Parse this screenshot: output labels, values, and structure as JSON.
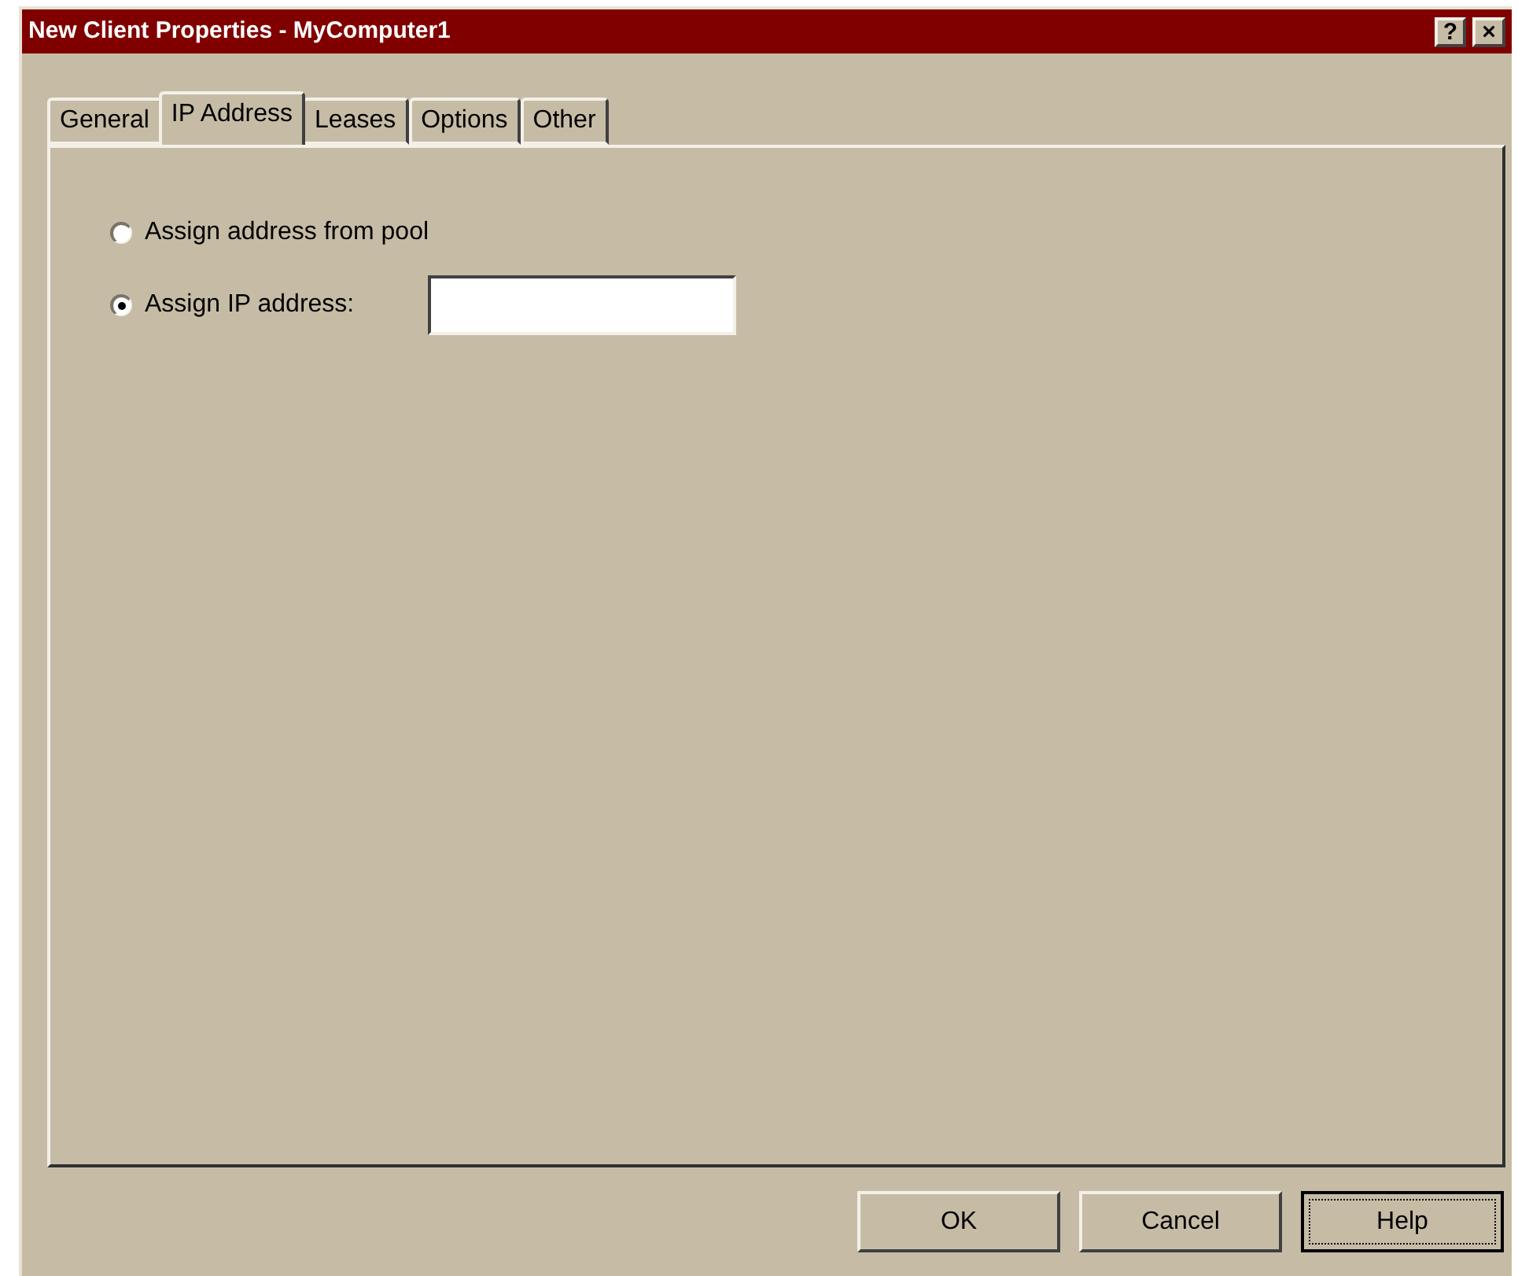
{
  "window": {
    "title": "New Client Properties - MyComputer1",
    "title_buttons": [
      {
        "kind": "help",
        "label": "?"
      },
      {
        "kind": "close",
        "label": "×"
      }
    ]
  },
  "tabs": [
    {
      "label": "General",
      "selected": false
    },
    {
      "label": "IP Address",
      "selected": true
    },
    {
      "label": "Leases",
      "selected": false
    },
    {
      "label": "Options",
      "selected": false
    },
    {
      "label": "Other",
      "selected": false
    }
  ],
  "options": [
    {
      "label": "Assign address from pool",
      "selected": false
    },
    {
      "label": "Assign IP address:",
      "selected": true,
      "kind": "field"
    }
  ],
  "buttons": [
    {
      "label": "OK",
      "focused": false
    },
    {
      "label": "Cancel",
      "focused": false
    },
    {
      "label": "Help",
      "focused": true
    }
  ]
}
